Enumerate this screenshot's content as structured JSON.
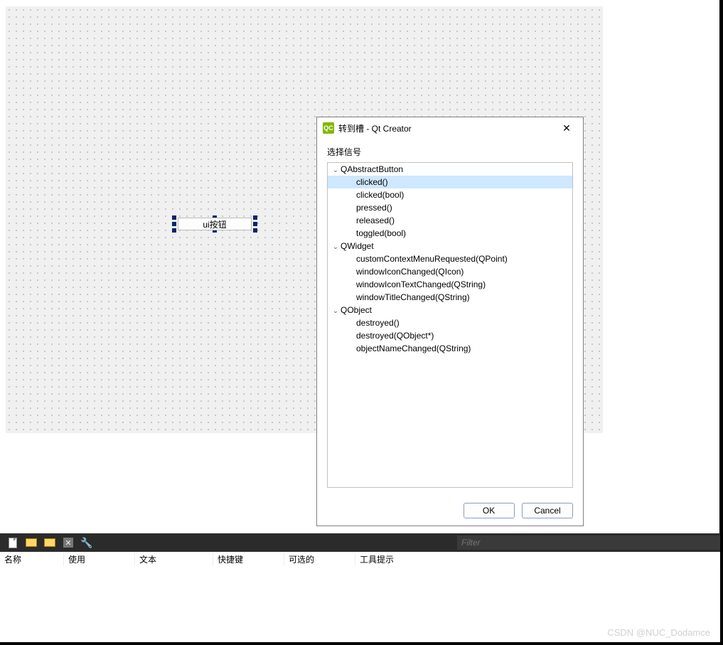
{
  "designer": {
    "button_text": "ui按钮"
  },
  "dialog": {
    "icon_text": "QC",
    "title": "转到槽 - Qt Creator",
    "section_label": "选择信号",
    "ok_label": "OK",
    "cancel_label": "Cancel",
    "tree": [
      {
        "level": 0,
        "expandable": true,
        "label": "QAbstractButton",
        "selected": false
      },
      {
        "level": 1,
        "expandable": false,
        "label": "clicked()",
        "selected": true
      },
      {
        "level": 1,
        "expandable": false,
        "label": "clicked(bool)",
        "selected": false
      },
      {
        "level": 1,
        "expandable": false,
        "label": "pressed()",
        "selected": false
      },
      {
        "level": 1,
        "expandable": false,
        "label": "released()",
        "selected": false
      },
      {
        "level": 1,
        "expandable": false,
        "label": "toggled(bool)",
        "selected": false
      },
      {
        "level": 0,
        "expandable": true,
        "label": "QWidget",
        "selected": false
      },
      {
        "level": 1,
        "expandable": false,
        "label": "customContextMenuRequested(QPoint)",
        "selected": false
      },
      {
        "level": 1,
        "expandable": false,
        "label": "windowIconChanged(QIcon)",
        "selected": false
      },
      {
        "level": 1,
        "expandable": false,
        "label": "windowIconTextChanged(QString)",
        "selected": false
      },
      {
        "level": 1,
        "expandable": false,
        "label": "windowTitleChanged(QString)",
        "selected": false
      },
      {
        "level": 0,
        "expandable": true,
        "label": "QObject",
        "selected": false
      },
      {
        "level": 1,
        "expandable": false,
        "label": "destroyed()",
        "selected": false
      },
      {
        "level": 1,
        "expandable": false,
        "label": "destroyed(QObject*)",
        "selected": false
      },
      {
        "level": 1,
        "expandable": false,
        "label": "objectNameChanged(QString)",
        "selected": false
      }
    ]
  },
  "toolbar": {
    "filter_placeholder": "Filter"
  },
  "columns": {
    "c0": "名称",
    "c1": "使用",
    "c2": "文本",
    "c3": "快捷键",
    "c4": "可选的",
    "c5": "工具提示"
  },
  "watermark": "CSDN @NUC_Dodamce"
}
